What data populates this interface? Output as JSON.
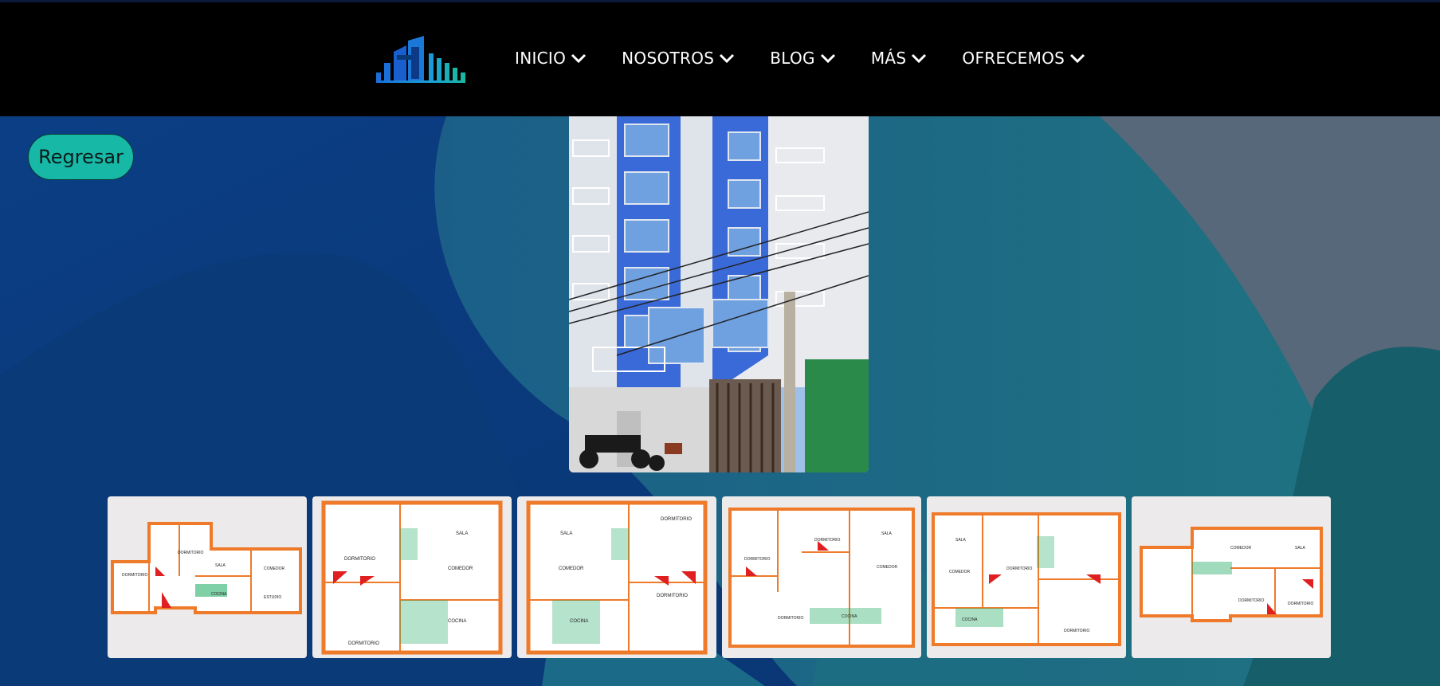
{
  "header": {
    "logo_icon": "building-bars-logo",
    "nav": [
      {
        "label": "INICIO",
        "icon": "chevron-down-icon"
      },
      {
        "label": "NOSOTROS",
        "icon": "chevron-down-icon"
      },
      {
        "label": "BLOG",
        "icon": "chevron-down-icon"
      },
      {
        "label": "MÁS",
        "icon": "chevron-down-icon"
      },
      {
        "label": "OFRECEMOS",
        "icon": "chevron-down-icon"
      }
    ]
  },
  "back_button": {
    "label": "Regresar"
  },
  "main_photo": {
    "subject": "blue apartment building facade"
  },
  "thumbnails": [
    {
      "rooms": [
        "DORMITORIO",
        "SALA",
        "COMEDOR",
        "COCINA",
        "ESTUDIO",
        "DORMITORIO"
      ]
    },
    {
      "rooms": [
        "SALA",
        "DORMITORIO",
        "COMEDOR",
        "COCINA",
        "DORMITORIO"
      ]
    },
    {
      "rooms": [
        "SALA",
        "DORMITORIO",
        "COMEDOR",
        "COCINA",
        "DORMITORIO"
      ]
    },
    {
      "rooms": [
        "DORMITORIO",
        "DORMITORIO",
        "SALA",
        "COMEDOR",
        "COCINA",
        "DORMITORIO"
      ]
    },
    {
      "rooms": [
        "SALA",
        "DORMITORIO",
        "COMEDOR",
        "COCINA",
        "DORMITORIO"
      ]
    },
    {
      "rooms": [
        "COMEDOR",
        "SALA",
        "DORMITORIO",
        "DORMITORIO"
      ]
    }
  ],
  "colors": {
    "header_bg": "#000000",
    "accent_button": "#18b8a6",
    "bg_blue": "#0a3a7a",
    "bg_teal": "#1e6a80",
    "plan_orange": "#ee7a2a"
  }
}
